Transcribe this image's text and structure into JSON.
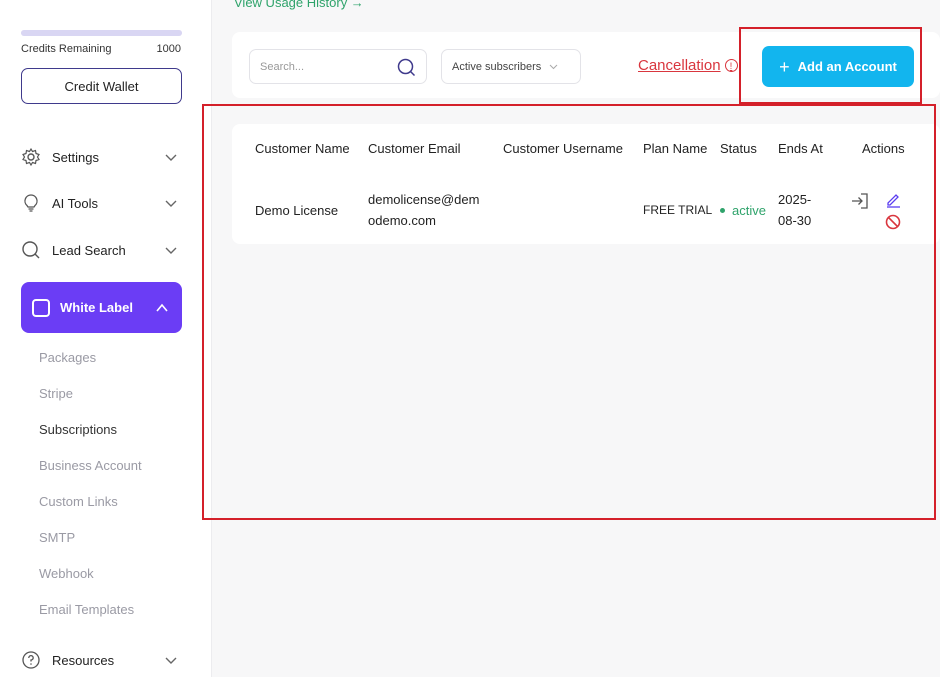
{
  "sidebar": {
    "credits_remaining_label": "Credits Remaining",
    "credits_remaining_value": "1000",
    "credit_wallet_label": "Credit Wallet",
    "nav": [
      {
        "label": "Settings",
        "icon": "gear-icon"
      },
      {
        "label": "AI Tools",
        "icon": "lightbulb-icon"
      },
      {
        "label": "Lead Search",
        "icon": "search-icon"
      },
      {
        "label": "White Label",
        "icon": "square-icon",
        "active": true
      },
      {
        "label": "Resources",
        "icon": "help-circle-icon"
      }
    ],
    "white_label_items": [
      {
        "label": "Packages"
      },
      {
        "label": "Stripe"
      },
      {
        "label": "Subscriptions",
        "active": true
      },
      {
        "label": "Business Account"
      },
      {
        "label": "Custom Links"
      },
      {
        "label": "SMTP"
      },
      {
        "label": "Webhook"
      },
      {
        "label": "Email Templates"
      }
    ]
  },
  "main": {
    "usage_link": "View Usage History →",
    "search_placeholder": "Search...",
    "filter_value": "Active subscribers",
    "cancellation_label": "Cancellation",
    "add_account_label": "Add an Account",
    "table": {
      "headers": [
        "Customer Name",
        "Customer Email",
        "Customer Username",
        "Plan Name",
        "Status",
        "Ends At",
        "Actions"
      ],
      "rows": [
        {
          "customer_name": "Demo License",
          "email_line1": "demolicense@dem",
          "email_line2": "odemo.com",
          "username": "",
          "plan": "FREE TRIAL",
          "status": "active",
          "ends_line1": "2025-",
          "ends_line2": "08-30"
        }
      ]
    }
  },
  "colors": {
    "accent_purple": "#6b3df5",
    "button_blue": "#12b5ee",
    "cancel_red": "#d9363e",
    "status_green": "#2fa36b",
    "highlight_red": "#d4202a"
  }
}
